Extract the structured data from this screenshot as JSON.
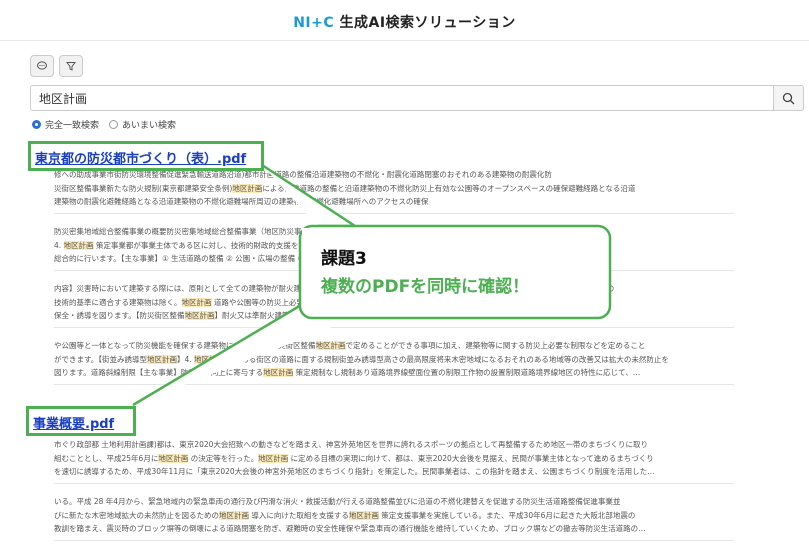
{
  "header": {
    "brand": "NI+C",
    "title_rest": " 生成AI検索ソリューション"
  },
  "toolbar": {
    "chat_icon": "chat-bubble-icon",
    "filter_icon": "filter-icon"
  },
  "search": {
    "value": "地区計画",
    "button_icon": "search-icon"
  },
  "modes": {
    "exact": "完全一致検索",
    "fuzzy": "あいまい検索",
    "selected": "exact"
  },
  "results": [
    {
      "title": "東京都の防災都市づくり（表）.pdf",
      "snippets": [
        [
          "修への助成事業市街防災環境整備促進緊急輸送道路沿道)都市計画道路の整備沿道建築物の不燃化・耐震化道路閉塞のおそれのある建築物の耐震化防",
          "災街区整備事業新たな防火規制(東京都建築安全条例)地区計画による避難道路の整備と沿道建築物の不燃化防災上有効な公園等のオープンスペースの確保避難経路となる沿道",
          "建築物の耐震化避難経路となる沿道建築物の不燃化避難場所周辺の建築物の不燃化避難場所へのアクセスの確保"
        ],
        [
          "防災密集地域総合整備事業の概要防災密集地域総合整備事業（地区防災事業）と〇〇事業住区整備事業、地区施設整備事業、避難道路整備・不燃化促進事業",
          "4. 地区計画 策定事業都が事業主体である区に対し、技術的財政的支援を行うとともに、防災地区計画を定め、地域の安全性の向上と居住環境の整備を",
          "総合的に行います。【主な事業】① 生活道路の整備 ② 公園・広場の整備 ③ 老朽建築物の建替え促進 ④ 防災街区整備事業公園の整備…"
        ],
        [
          "内容】災害時において建築する際には、原則として全ての建築物が耐火建築物又は準耐火建築物とし、かつ、延焼防止上必要な措置をしなければなりません。※一定の",
          "技術的基準に適合する建築物は除く。地区計画 道路や公園等の防災上必要な施設を計画的に配置し、かつ、建築物の建て方のルールを定めた良好な住環境や街なみの",
          "保全・誘導を図ります。【防災街区整備地区計画】耐火又は準耐火建築物等とするほか、防火上・避難上の観点から、間口率の最低限度・敷地面…"
        ],
        [
          "や公園等と一体となって防災機能を確保する建築物については、防災街区整備地区計画で定めることができる事項に加え、建築物等に関する防災上必要な制限などを定めること",
          "ができます。【街並み誘導型地区計画】4. 地区計画 で定める街区の道路に面する規制街並み誘導型高さの最高限度将来木密地域になるおそれのある地域等の改善又は拡大の未然防止を",
          "図ります。道路斜線制限【主な事業】防災性の向上に寄与する地区計画 策定規制なし規制あり道路境界線壁面位置の制限工作物の設置制限道路境界線地区の特性に応じて、…"
        ]
      ]
    },
    {
      "title": "事業概要.pdf",
      "snippets": [
        [
          "市ぐり政部都 土地利用計画課)都は、東京2020大会招致への動きなどを踏まえ、神宮外苑地区を世界に誇れるスポーツの拠点として再整備するため地区一帯のまちづくりに取り",
          "組むこととし、平成25年6月に地区計画 の決定等を行った。地区計画 に定める目標の実現に向けて、都は、東京2020大会後を見据え、民間が事業主体となって進めるまちづくり",
          "を速切に誘導するため、平成30年11月に「東京2020大会後の神宮外苑地区のまちづくり指針」を策定した。民間事業者は、この指針を踏まえ、公園まちづくり制度を活用した…"
        ],
        [
          "いる。平成 28 年4月から、緊急地域内の緊急車両の通行及び円滑な消火・救援活動が行える道路整備並びに沿道の不燃化建替えを促進する防災生活道路整備促進事業並",
          "びに新たな木密地域拡大の未然防止を図るための地区計画 導入に向けた取組を支援する地区計画 策定支援事業を実施している。また、平成30年6月に起きた大阪北部地震の",
          "教訓を踏まえ、震災時のブロック塀等の倒壊による道路閉塞を防ぎ、避難時の安全性確保や緊急車両の通行機能を維持していくため、ブロック塀などの撤去等防災生活道路の…"
        ]
      ]
    }
  ],
  "callout": {
    "line1": "課題3",
    "line2": "複数のPDFを同時に確認！"
  },
  "colors": {
    "accent": "#4caf50",
    "link": "#1a3fc4",
    "brand": "#1a9bd6",
    "highlight": "#fbe9b7"
  }
}
